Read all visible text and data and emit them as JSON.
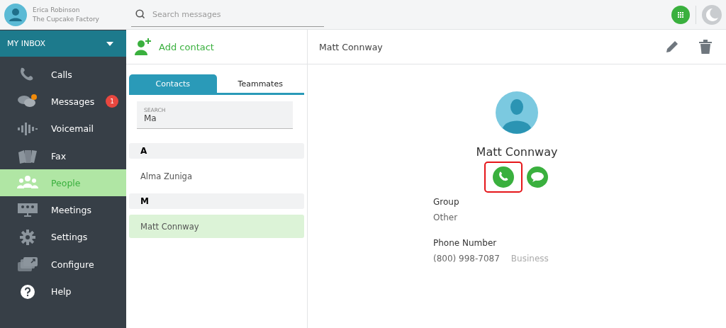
{
  "user": {
    "name": "Erica Robinson",
    "company": "The Cupcake Factory"
  },
  "search": {
    "placeholder": "Search messages"
  },
  "inbox": {
    "title": "MY INBOX"
  },
  "nav": [
    {
      "kind": "calls",
      "label": "Calls",
      "selected": false
    },
    {
      "kind": "messages",
      "label": "Messages",
      "selected": false,
      "badge": "1"
    },
    {
      "kind": "voicemail",
      "label": "Voicemail",
      "selected": false
    },
    {
      "kind": "fax",
      "label": "Fax",
      "selected": false
    },
    {
      "kind": "people",
      "label": "People",
      "selected": true
    },
    {
      "kind": "meetings",
      "label": "Meetings",
      "selected": false
    },
    {
      "kind": "settings",
      "label": "Settings",
      "selected": false
    },
    {
      "kind": "configure",
      "label": "Configure",
      "selected": false
    },
    {
      "kind": "help",
      "label": "Help",
      "selected": false
    }
  ],
  "add_contact": {
    "label": "Add contact"
  },
  "tabs": [
    {
      "label": "Contacts",
      "selected": true
    },
    {
      "label": "Teammates",
      "selected": false
    }
  ],
  "contact_search": {
    "label": "SEARCH",
    "value": "Ma"
  },
  "contact_groups": [
    {
      "letter": "A",
      "contacts": [
        {
          "name": "Alma Zuniga",
          "selected": false
        }
      ]
    },
    {
      "letter": "M",
      "contacts": [
        {
          "name": "Matt Connway",
          "selected": true
        }
      ]
    }
  ],
  "detail": {
    "header_name": "Matt Connway",
    "name": "Matt Connway",
    "actions": [
      {
        "kind": "call",
        "highlighted": true
      },
      {
        "kind": "message",
        "highlighted": false
      }
    ],
    "fields": [
      {
        "label": "Group",
        "value": "Other"
      },
      {
        "label": "Phone Number",
        "value": "(800) 998-7087",
        "note": "Business"
      }
    ]
  }
}
